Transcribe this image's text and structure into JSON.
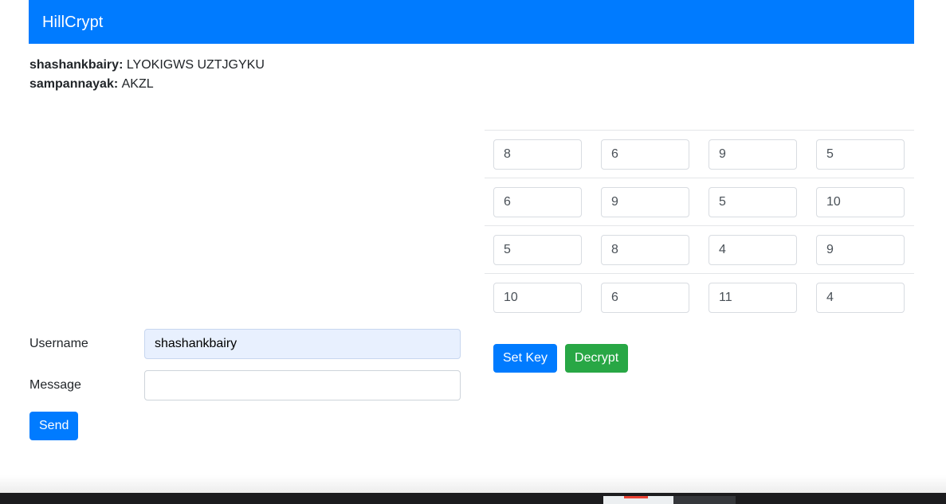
{
  "navbar": {
    "brand": "HillCrypt",
    "brand_color": "#007bff"
  },
  "messages": [
    {
      "user": "shashankbairy",
      "separator": ": ",
      "text": "LYOKIGWS UZTJGYKU"
    },
    {
      "user": "sampannayak",
      "separator": ": ",
      "text": "AKZL"
    }
  ],
  "form": {
    "username_label": "Username",
    "username_value": "shashankbairy",
    "username_placeholder": "",
    "message_label": "Message",
    "message_value": "",
    "message_placeholder": "",
    "send_label": "Send",
    "send_color": "#007bff"
  },
  "key_matrix": {
    "rows": [
      [
        "8",
        "6",
        "9",
        "5"
      ],
      [
        "6",
        "9",
        "5",
        "10"
      ],
      [
        "5",
        "8",
        "4",
        "9"
      ],
      [
        "10",
        "6",
        "11",
        "4"
      ]
    ],
    "set_key_label": "Set Key",
    "set_key_color": "#007bff",
    "decrypt_label": "Decrypt",
    "decrypt_color": "#28a745"
  }
}
